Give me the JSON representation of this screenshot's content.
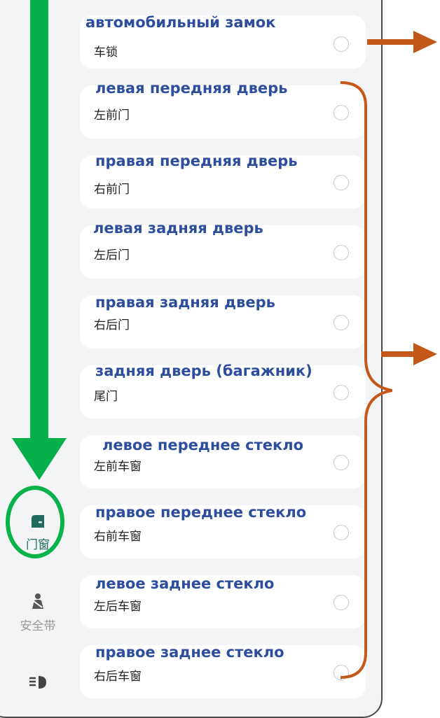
{
  "sidebar": {
    "items": [
      {
        "label": "",
        "icon": "generic-icon"
      },
      {
        "label": "",
        "icon": "generic-icon"
      },
      {
        "label": "",
        "icon": "generic-icon"
      },
      {
        "label": "",
        "icon": "generic-icon"
      },
      {
        "label": "",
        "icon": "generic-icon"
      },
      {
        "label": "",
        "icon": "generic-icon"
      },
      {
        "label": "门窗",
        "icon": "car-door-icon",
        "active": true
      },
      {
        "label": "安全带",
        "icon": "seatbelt-person-icon"
      },
      {
        "label": "",
        "icon": "headlight-icon"
      }
    ]
  },
  "options": [
    {
      "label": "车锁",
      "translation": "автомобильный замок"
    },
    {
      "label": "左前门",
      "translation": "левая передняя дверь"
    },
    {
      "label": "右前门",
      "translation": "правая передняя дверь"
    },
    {
      "label": "左后门",
      "translation": "левая задняя дверь"
    },
    {
      "label": "右后门",
      "translation": "правая задняя дверь"
    },
    {
      "label": "尾门",
      "translation": "задняя дверь (багажник)"
    },
    {
      "label": "左前车窗",
      "translation": "левое переднее стекло"
    },
    {
      "label": "右前车窗",
      "translation": "правое переднее стекло"
    },
    {
      "label": "左后车窗",
      "translation": "левое заднее стекло"
    },
    {
      "label": "右后车窗",
      "translation": "правое заднее стекло"
    }
  ],
  "colors": {
    "translation_text": "#2d4e9d",
    "green_arrow": "#06b04b",
    "orange_annotation": "#c4581a",
    "active_icon": "#1f6b5e"
  }
}
